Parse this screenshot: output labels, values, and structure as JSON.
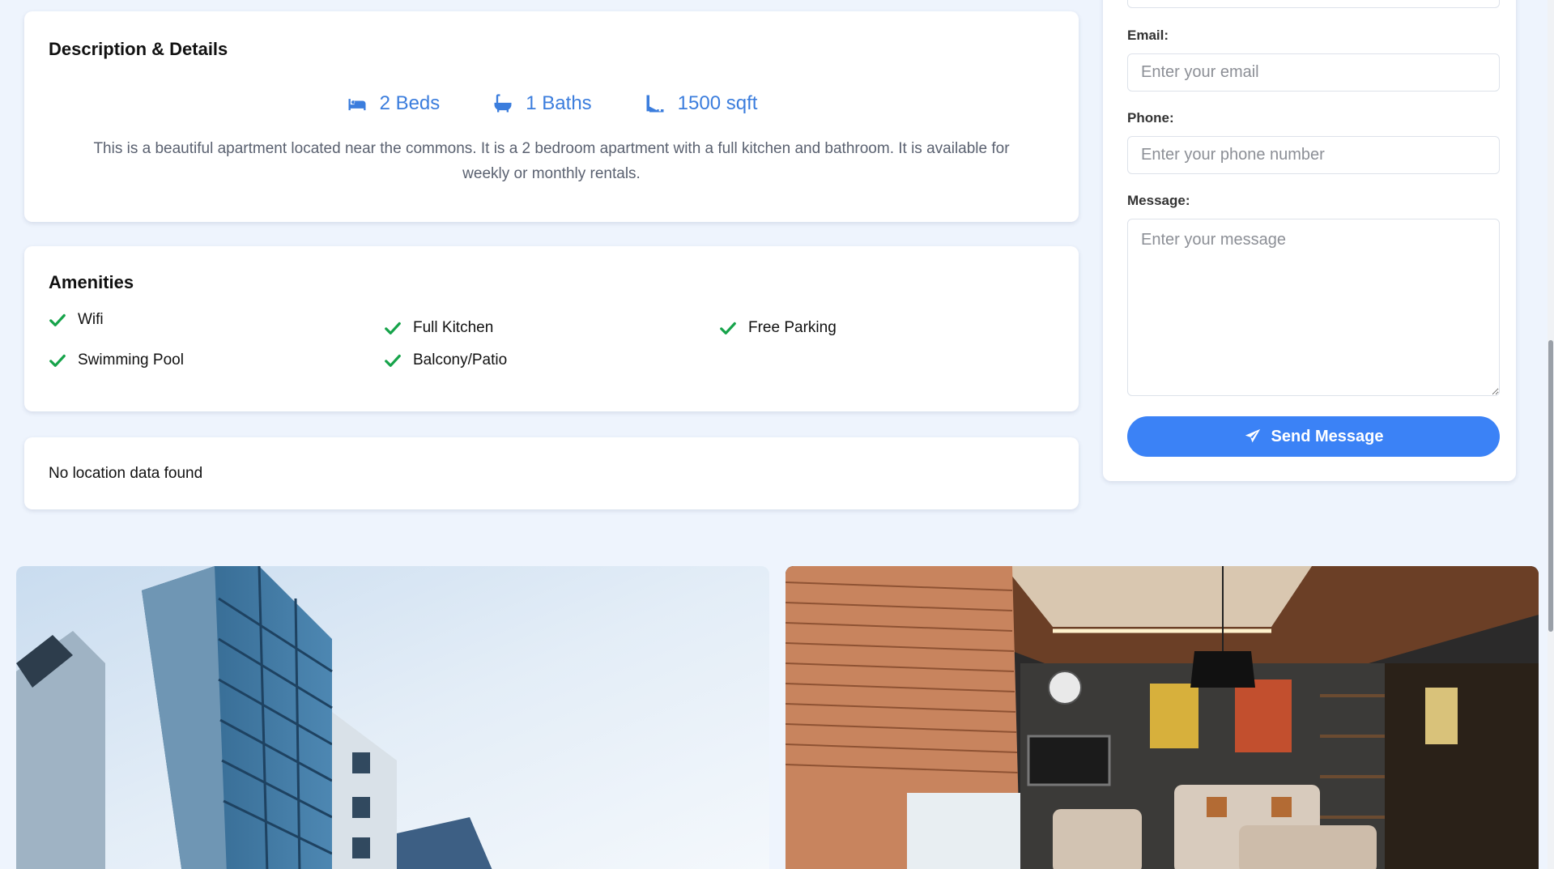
{
  "description": {
    "title": "Description & Details",
    "beds": "2 Beds",
    "baths": "1 Baths",
    "area": "1500 sqft",
    "text": "This is a beautiful apartment located near the commons. It is a 2 bedroom apartment with a full kitchen and bathroom. It is available for weekly or monthly rentals."
  },
  "amenities": {
    "title": "Amenities",
    "items": [
      "Wifi",
      "Full Kitchen",
      "Free Parking",
      "Swimming Pool",
      "Balcony/Patio"
    ]
  },
  "location": {
    "message": "No location data found"
  },
  "contact_form": {
    "email_label": "Email:",
    "email_placeholder": "Enter your email",
    "phone_label": "Phone:",
    "phone_placeholder": "Enter your phone number",
    "message_label": "Message:",
    "message_placeholder": "Enter your message",
    "send_label": "Send Message"
  },
  "colors": {
    "accent": "#3b82f6",
    "stat_blue": "#3b7ddd",
    "check_green": "#16a34a",
    "page_bg": "#eef4fd"
  },
  "icons": [
    "bed-icon",
    "bath-icon",
    "ruler-icon",
    "check-icon",
    "paper-plane-icon"
  ]
}
